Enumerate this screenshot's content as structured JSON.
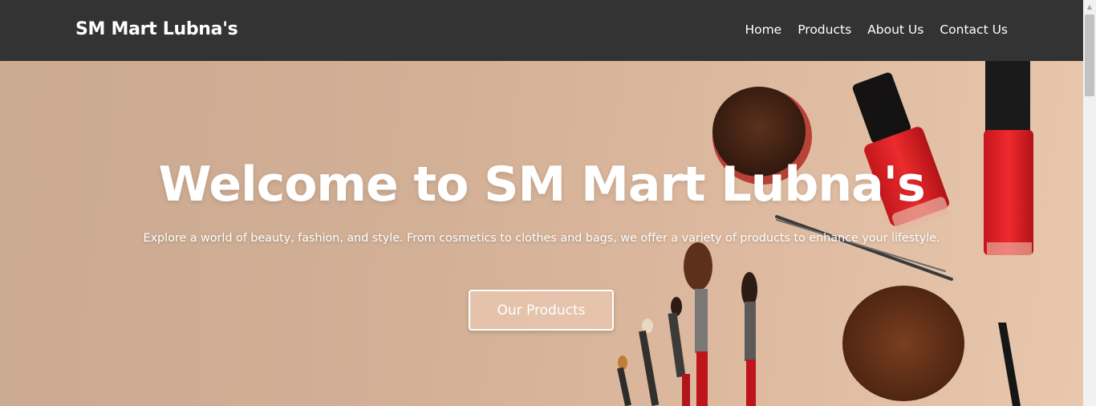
{
  "nav": {
    "brand": "SM Mart Lubna's",
    "links": [
      "Home",
      "Products",
      "About Us",
      "Contact Us"
    ]
  },
  "hero": {
    "title": "Welcome to SM Mart Lubna's",
    "subtitle": "Explore a world of beauty, fashion, and style. From cosmetics to clothes and bags, we offer a variety of products to enhance your lifestyle.",
    "button_label": "Our Products"
  },
  "colors": {
    "navbar": "#333333",
    "hero_background": "#d9b79d",
    "text_light": "#ffffff",
    "nail_polish_red": "#e2181c"
  },
  "icons": {
    "scroll_up": "triangle-up",
    "scroll_down": "triangle-down"
  }
}
